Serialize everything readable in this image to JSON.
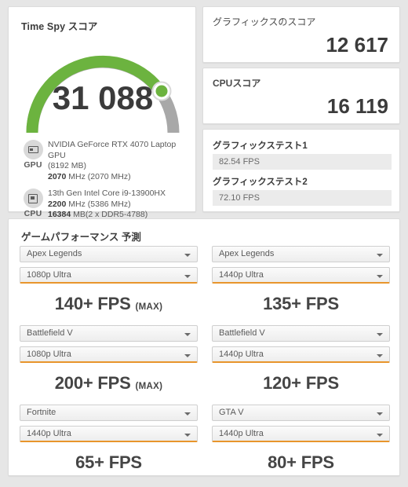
{
  "timespy": {
    "title": "Time Spy スコア",
    "score": "31 088",
    "gauge": {
      "arc_color": "#6cb33f",
      "track_color": "#a8a8a8",
      "percent": 82
    },
    "hardware": [
      {
        "icon": "gpu-icon",
        "icon_label": "GPU",
        "line1": "NVIDIA GeForce RTX 4070 Laptop GPU",
        "line2": "(8192 MB)",
        "clock_bold": "2070",
        "clock_rest": " MHz (2070 MHz)"
      },
      {
        "icon": "cpu-icon",
        "icon_label": "CPU",
        "line1": "13th Gen Intel Core i9-13900HX",
        "clock_bold": "2200",
        "clock_rest": " MHz (5386 MHz)",
        "mem_bold": "16384",
        "mem_rest": " MB(2 x DDR5-4788)"
      }
    ]
  },
  "graphics_score": {
    "title": "グラフィックスのスコア",
    "value": "12 617"
  },
  "cpu_score": {
    "title": "CPUスコア",
    "value": "16 119"
  },
  "graphics_tests": {
    "tests": [
      {
        "label": "グラフィックステスト1",
        "value": "82.54 FPS"
      },
      {
        "label": "グラフィックステスト2",
        "value": "72.10 FPS"
      }
    ]
  },
  "game_performance": {
    "title": "ゲームパフォーマンス 予測",
    "accent_color": "#e8952c",
    "cells": [
      {
        "game": "Apex Legends",
        "preset": "1080p Ultra",
        "fps": "140+ FPS",
        "max": "(MAX)"
      },
      {
        "game": "Apex Legends",
        "preset": "1440p Ultra",
        "fps": "135+ FPS",
        "max": ""
      },
      {
        "game": "Battlefield V",
        "preset": "1080p Ultra",
        "fps": "200+ FPS",
        "max": "(MAX)"
      },
      {
        "game": "Battlefield V",
        "preset": "1440p Ultra",
        "fps": "120+ FPS",
        "max": ""
      },
      {
        "game": "Fortnite",
        "preset": "1440p Ultra",
        "fps": "65+ FPS",
        "max": ""
      },
      {
        "game": "GTA V",
        "preset": "1440p Ultra",
        "fps": "80+ FPS",
        "max": ""
      }
    ]
  }
}
